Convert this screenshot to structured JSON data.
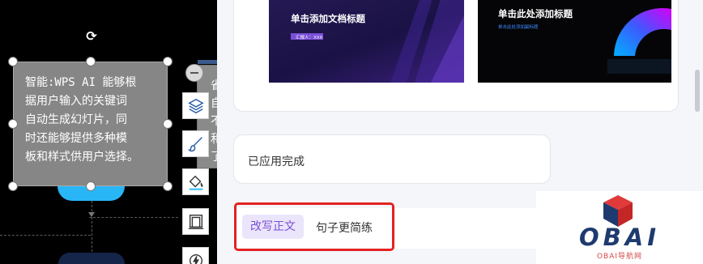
{
  "editor": {
    "text_box_text": "智能:WPS AI 能够根\n据用户输入的关键词\n自动生成幻灯片，同\n时还能够提供多种模\n板和样式供用户选择。",
    "background_box_text": [
      "省",
      "自",
      "不",
      "和",
      "了"
    ],
    "toolbar": [
      {
        "name": "layers-icon"
      },
      {
        "name": "brush-icon"
      },
      {
        "name": "fill-bucket-icon"
      },
      {
        "name": "frame-icon"
      },
      {
        "name": "animation-icon"
      }
    ]
  },
  "panel": {
    "templates": [
      {
        "title": "单击添加文档标题",
        "subtitle": "汇报人：XXX",
        "bg": "#1a1245",
        "accent": "#7a4fd6"
      },
      {
        "title": "单击此处添加标题",
        "subtitle": "单击此处添加副标题",
        "bg": "#050508",
        "accent": "#3d5afe"
      }
    ],
    "status": "已应用完成",
    "suggestion": {
      "tag": "改写正文",
      "text": "句子更简练"
    }
  },
  "watermark": {
    "logo_text": "OBAI",
    "sub_text": "OBAI导航网"
  },
  "colors": {
    "accent_purple": "#7a4fd6",
    "highlight_red": "#e32222",
    "selection_blue": "#4fc3f7"
  }
}
